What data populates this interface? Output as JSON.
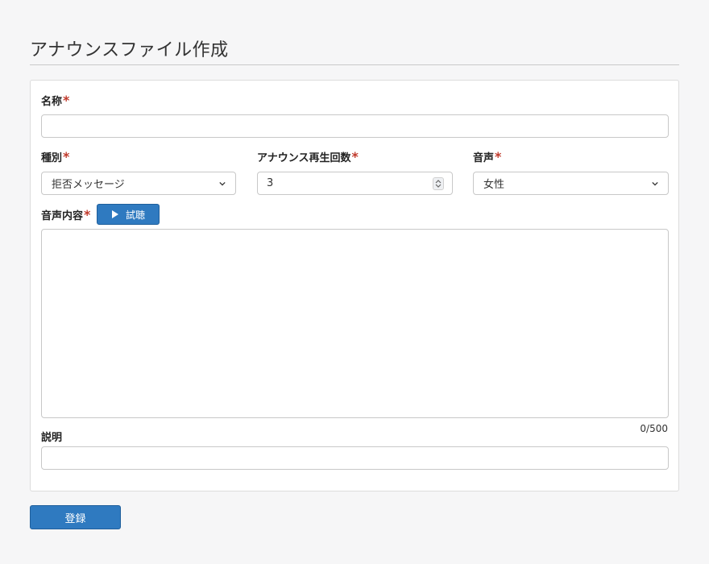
{
  "page": {
    "title": "アナウンスファイル作成"
  },
  "form": {
    "name": {
      "label": "名称",
      "required_mark": "*",
      "value": ""
    },
    "type": {
      "label": "種別",
      "required_mark": "*",
      "value": "拒否メッセージ"
    },
    "repeat": {
      "label": "アナウンス再生回数",
      "required_mark": "*",
      "value": "3"
    },
    "voice": {
      "label": "音声",
      "required_mark": "*",
      "value": "女性"
    },
    "content": {
      "label": "音声内容",
      "required_mark": "*",
      "value": "",
      "counter": "0/500"
    },
    "preview_button": {
      "label": "試聴",
      "icon": "play-icon"
    },
    "description": {
      "label": "説明",
      "value": ""
    }
  },
  "actions": {
    "submit_label": "登録"
  },
  "colors": {
    "primary": "#2f7ac0",
    "required": "#c0392b",
    "background": "#f6f6f7"
  }
}
